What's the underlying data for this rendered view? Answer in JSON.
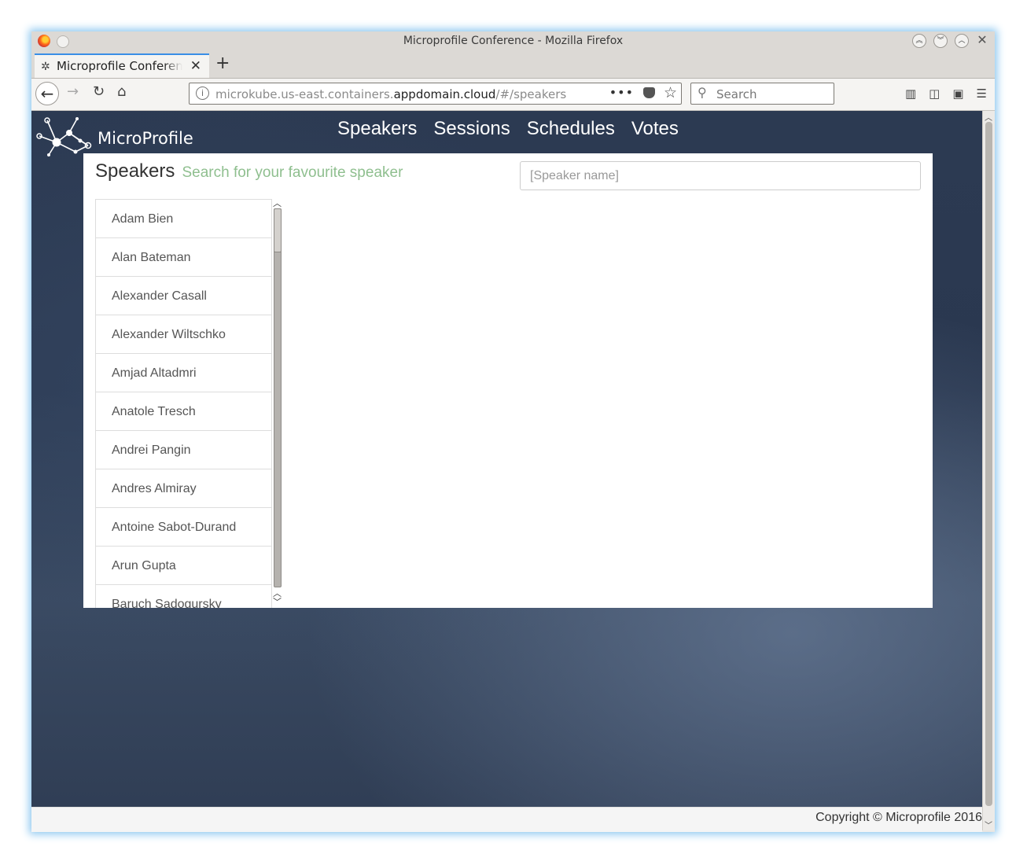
{
  "window": {
    "title": "Microprofile Conference - Mozilla Firefox"
  },
  "tab": {
    "title": "Microprofile Conference",
    "close": "✕",
    "new_tab": "+"
  },
  "address": {
    "url_prefix": "microkube.us-east.containers.",
    "url_domain": "appdomain.cloud",
    "url_path": "/#/speakers",
    "more": "•••"
  },
  "browser_search": {
    "placeholder": "Search"
  },
  "site": {
    "logo_text": "MicroProfile",
    "nav": [
      "Speakers",
      "Sessions",
      "Schedules",
      "Votes"
    ]
  },
  "speakers_panel": {
    "title": "Speakers",
    "subtitle": "Search for your favourite speaker",
    "search_placeholder": "[Speaker name]",
    "speakers": [
      "Adam Bien",
      "Alan Bateman",
      "Alexander Casall",
      "Alexander Wiltschko",
      "Amjad Altadmri",
      "Anatole Tresch",
      "Andrei Pangin",
      "Andres Almiray",
      "Antoine Sabot-Durand",
      "Arun Gupta",
      "Baruch Sadogursky"
    ]
  },
  "footer": {
    "copyright": "Copyright © Microprofile 2016"
  },
  "icons": {
    "back": "arrow-left-icon",
    "forward": "arrow-right-icon",
    "reload": "reload-icon",
    "home": "home-icon",
    "library": "library-icon",
    "sidebar": "sidebar-icon",
    "menu": "hamburger-menu-icon"
  }
}
